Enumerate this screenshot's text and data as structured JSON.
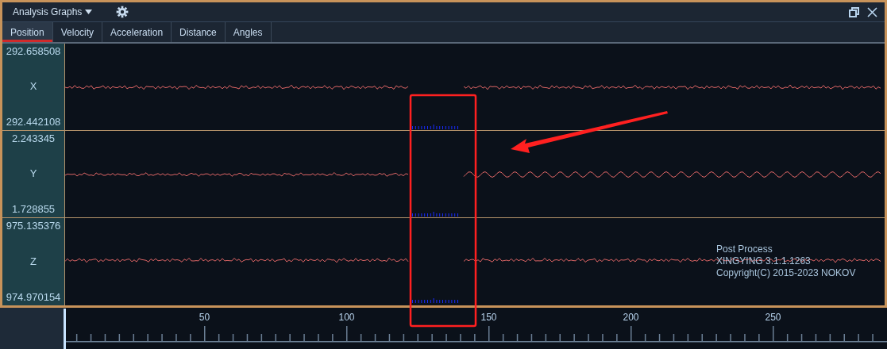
{
  "window": {
    "title": "Analysis Graphs"
  },
  "tabs": [
    {
      "label": "Position",
      "selected": true
    },
    {
      "label": "Velocity",
      "selected": false
    },
    {
      "label": "Acceleration",
      "selected": false
    },
    {
      "label": "Distance",
      "selected": false
    },
    {
      "label": "Angles",
      "selected": false
    }
  ],
  "plots": [
    {
      "axis": "X",
      "max": "292.658508",
      "min": "292.442108"
    },
    {
      "axis": "Y",
      "max": "2.243345",
      "min": "1.728855"
    },
    {
      "axis": "Z",
      "max": "975.135376",
      "min": "974.970154"
    }
  ],
  "overlay_text": [
    "Post Process",
    "XINGYING 3.1.1.1263",
    "Copyright(C) 2015-2023 NOKOV"
  ],
  "timeline": {
    "tick_labels": [
      "50",
      "100",
      "150",
      "200",
      "250"
    ]
  }
}
